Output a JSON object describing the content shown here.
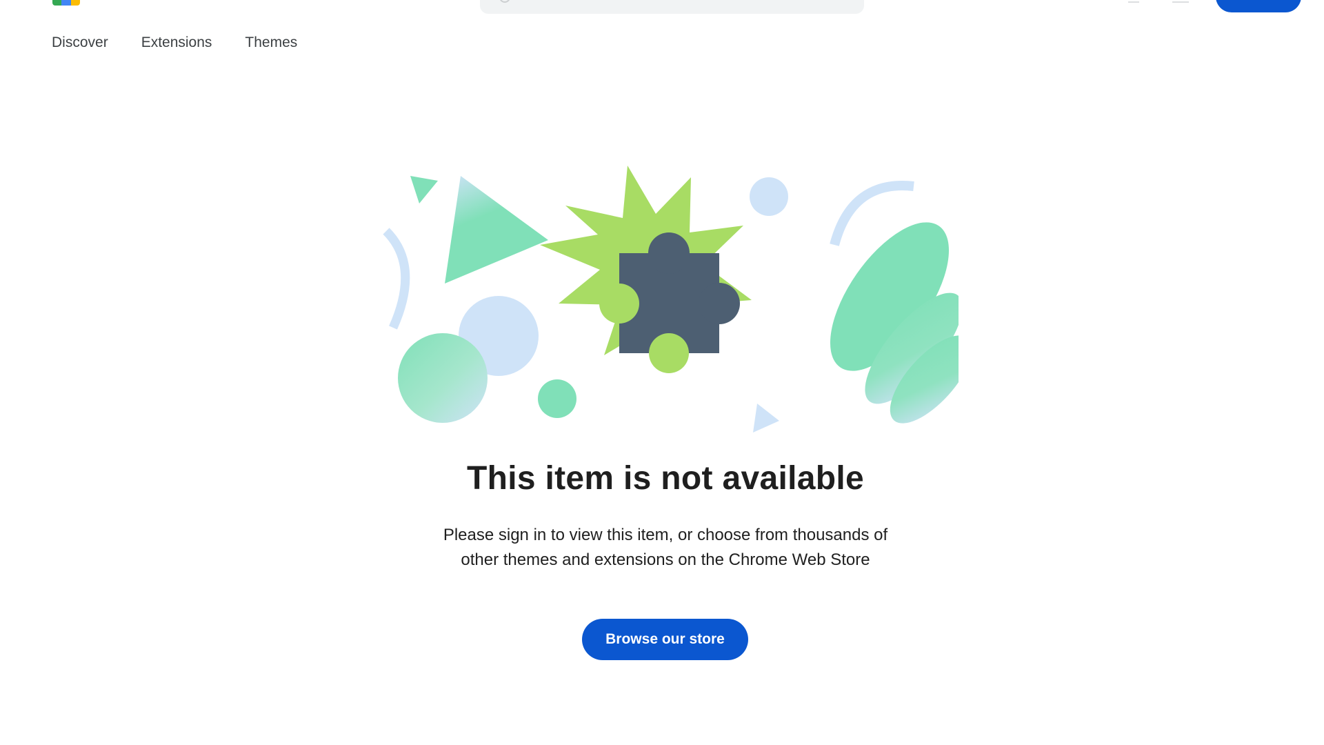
{
  "header": {
    "logo_colors": [
      "#34a853",
      "#4285f4",
      "#fbbc04"
    ],
    "search_icon": "search-icon",
    "accent_color": "#0b57d0"
  },
  "nav": {
    "items": [
      {
        "label": "Discover"
      },
      {
        "label": "Extensions"
      },
      {
        "label": "Themes"
      }
    ]
  },
  "illustration": {
    "icon": "puzzle-piece-icon",
    "colors": {
      "starburst": "#a8dc64",
      "puzzle": "#4d5f72",
      "mint": "#80e0b8",
      "pale_blue": "#cfe3f8"
    }
  },
  "main": {
    "title": "This item is not available",
    "subtitle_line1": "Please sign in to view this item, or choose from thousands of",
    "subtitle_line2": "other themes and extensions on the Chrome Web Store",
    "browse_button_label": "Browse our store"
  }
}
